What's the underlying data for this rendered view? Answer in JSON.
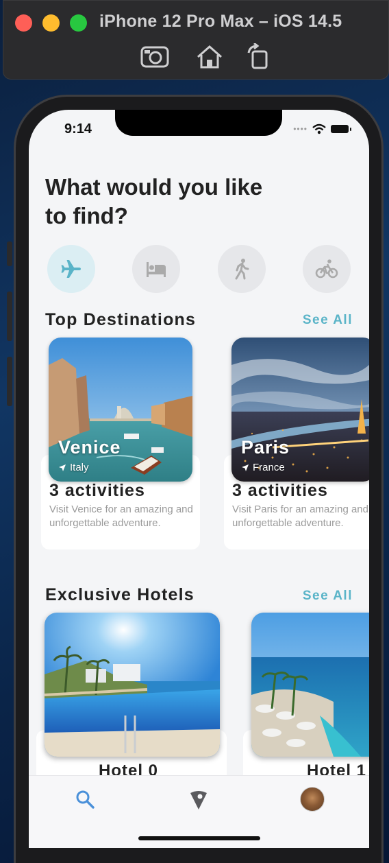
{
  "simulator": {
    "title": "iPhone 12 Pro Max – iOS 14.5",
    "tools": [
      "screenshot-icon",
      "home-icon",
      "rotate-icon"
    ]
  },
  "status_bar": {
    "time": "9:14"
  },
  "headline": "What would you like to find?",
  "categories": [
    {
      "icon": "airplane-icon",
      "active": true
    },
    {
      "icon": "bed-icon",
      "active": false
    },
    {
      "icon": "walking-icon",
      "active": false
    },
    {
      "icon": "bike-icon",
      "active": false
    }
  ],
  "top_destinations": {
    "title": "Top Destinations",
    "see_all": "See All",
    "items": [
      {
        "city": "Venice",
        "country": "Italy",
        "activities": "3 activities",
        "description": "Visit Venice for an amazing and unforgettable adventure."
      },
      {
        "city": "Paris",
        "country": "France",
        "activities": "3 activities",
        "description": "Visit Paris for an amazing and unforgettable adventure."
      }
    ]
  },
  "exclusive_hotels": {
    "title": "Exclusive Hotels",
    "see_all": "See All",
    "items": [
      {
        "name": "Hotel 0"
      },
      {
        "name": "Hotel 1"
      }
    ]
  },
  "tab_bar": {
    "items": [
      "search-icon",
      "map-pin-icon",
      "profile-avatar"
    ],
    "active_color": "#4a90d9"
  },
  "colors": {
    "accent": "#5ab4c8",
    "background": "#f4f5f7"
  }
}
